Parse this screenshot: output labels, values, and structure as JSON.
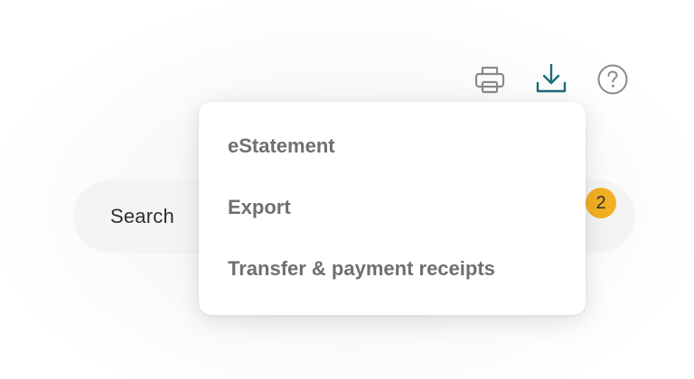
{
  "toolbar": {
    "icons": [
      "printer-icon",
      "download-icon",
      "help-icon"
    ],
    "accent_color": "#1b6b7a",
    "icon_color": "#8a8a8a"
  },
  "search": {
    "label": "Search",
    "badge_count": "2",
    "badge_color": "#f2b124"
  },
  "download_menu": {
    "items": [
      {
        "label": "eStatement"
      },
      {
        "label": "Export"
      },
      {
        "label": "Transfer & payment receipts"
      }
    ]
  }
}
